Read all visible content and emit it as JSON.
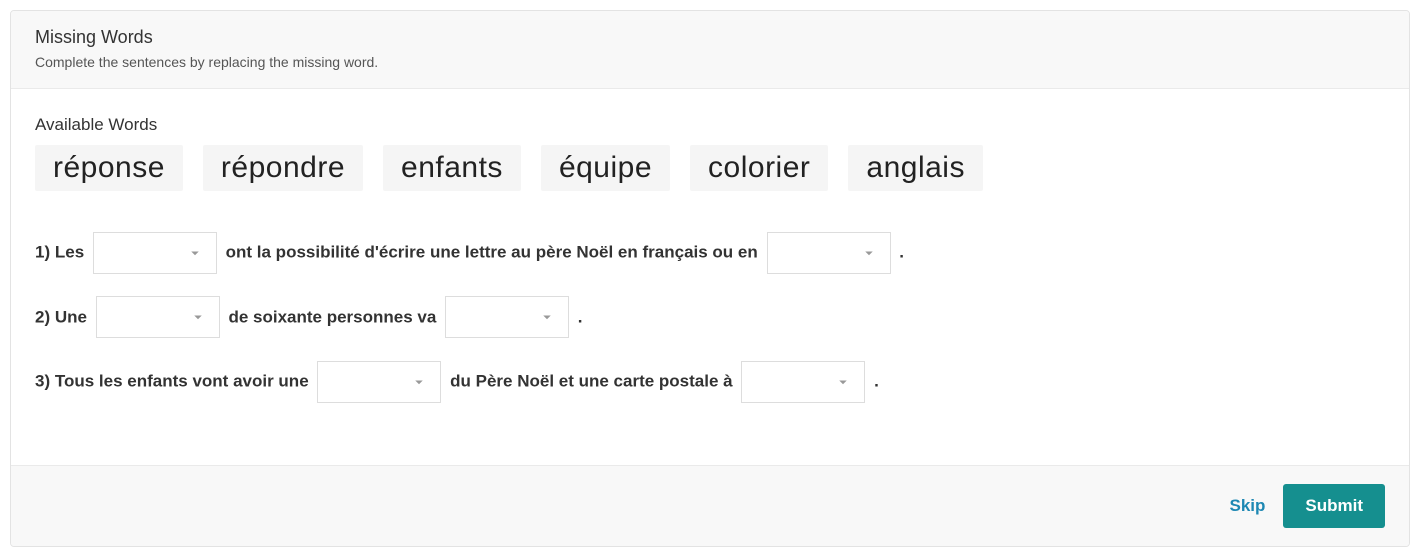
{
  "header": {
    "title": "Missing Words",
    "instructions": "Complete the sentences by replacing the missing word."
  },
  "available": {
    "label": "Available Words",
    "words": [
      "réponse",
      "répondre",
      "enfants",
      "équipe",
      "colorier",
      "anglais"
    ]
  },
  "sentences": [
    {
      "num": "1)",
      "parts": [
        "Les",
        null,
        "ont la possibilité d'écrire une lettre au père Noël en français ou en",
        null,
        "."
      ]
    },
    {
      "num": "2)",
      "parts": [
        "Une",
        null,
        "de soixante personnes va",
        null,
        "."
      ]
    },
    {
      "num": "3)",
      "parts": [
        "Tous les enfants vont avoir une",
        null,
        "du Père Noël et une carte postale à",
        null,
        "."
      ]
    }
  ],
  "footer": {
    "skip": "Skip",
    "submit": "Submit"
  }
}
